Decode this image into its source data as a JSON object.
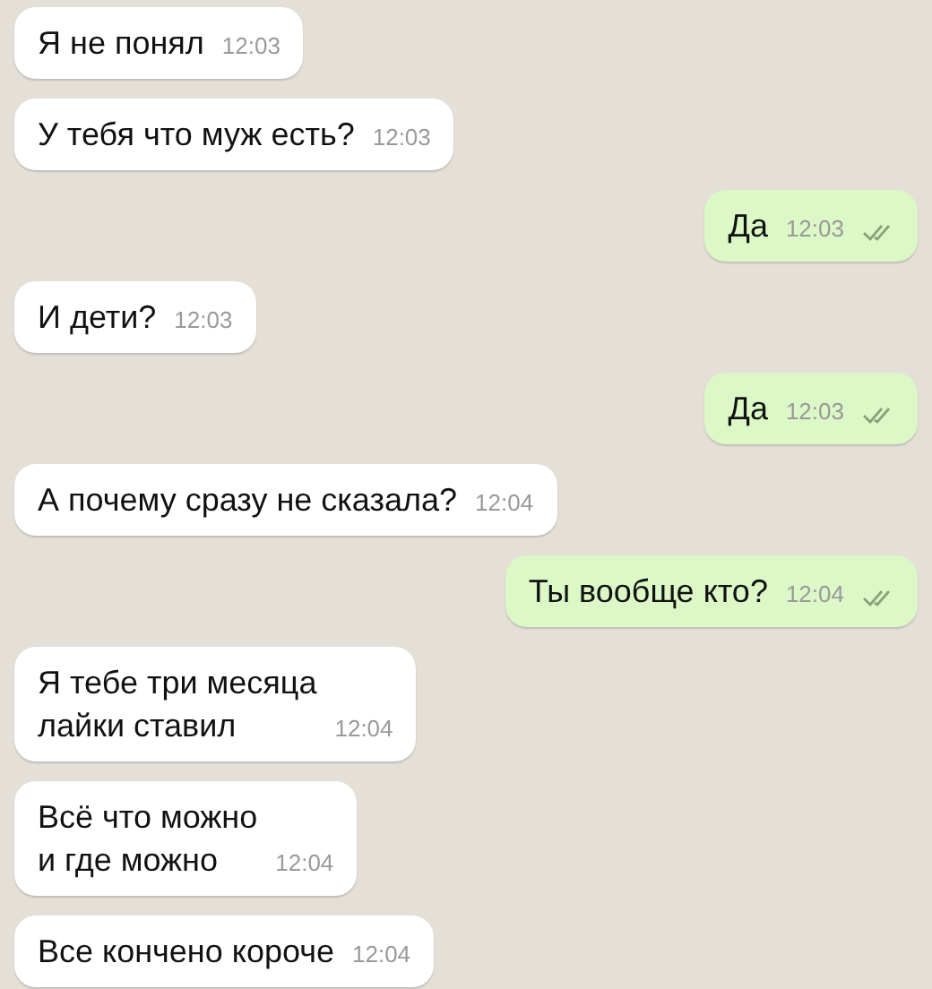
{
  "messages": [
    {
      "kind": "incoming",
      "lines": [
        "Я не понял"
      ],
      "time": "12:03"
    },
    {
      "kind": "incoming",
      "lines": [
        "У тебя что муж есть?"
      ],
      "time": "12:03"
    },
    {
      "kind": "outgoing",
      "lines": [
        "Да"
      ],
      "time": "12:03"
    },
    {
      "kind": "incoming",
      "lines": [
        "И дети?"
      ],
      "time": "12:03"
    },
    {
      "kind": "outgoing",
      "lines": [
        "Да"
      ],
      "time": "12:03"
    },
    {
      "kind": "incoming",
      "lines": [
        "А почему сразу не сказала?"
      ],
      "time": "12:04"
    },
    {
      "kind": "outgoing",
      "lines": [
        "Ты вообще кто?"
      ],
      "time": "12:04"
    },
    {
      "kind": "incoming",
      "lines": [
        "Я тебе три месяца",
        "лайки ставил"
      ],
      "time": "12:04"
    },
    {
      "kind": "incoming",
      "lines": [
        "Всё что можно",
        "и где можно"
      ],
      "time": "12:04"
    },
    {
      "kind": "incoming",
      "lines": [
        "Все кончено короче"
      ],
      "time": "12:04"
    }
  ]
}
